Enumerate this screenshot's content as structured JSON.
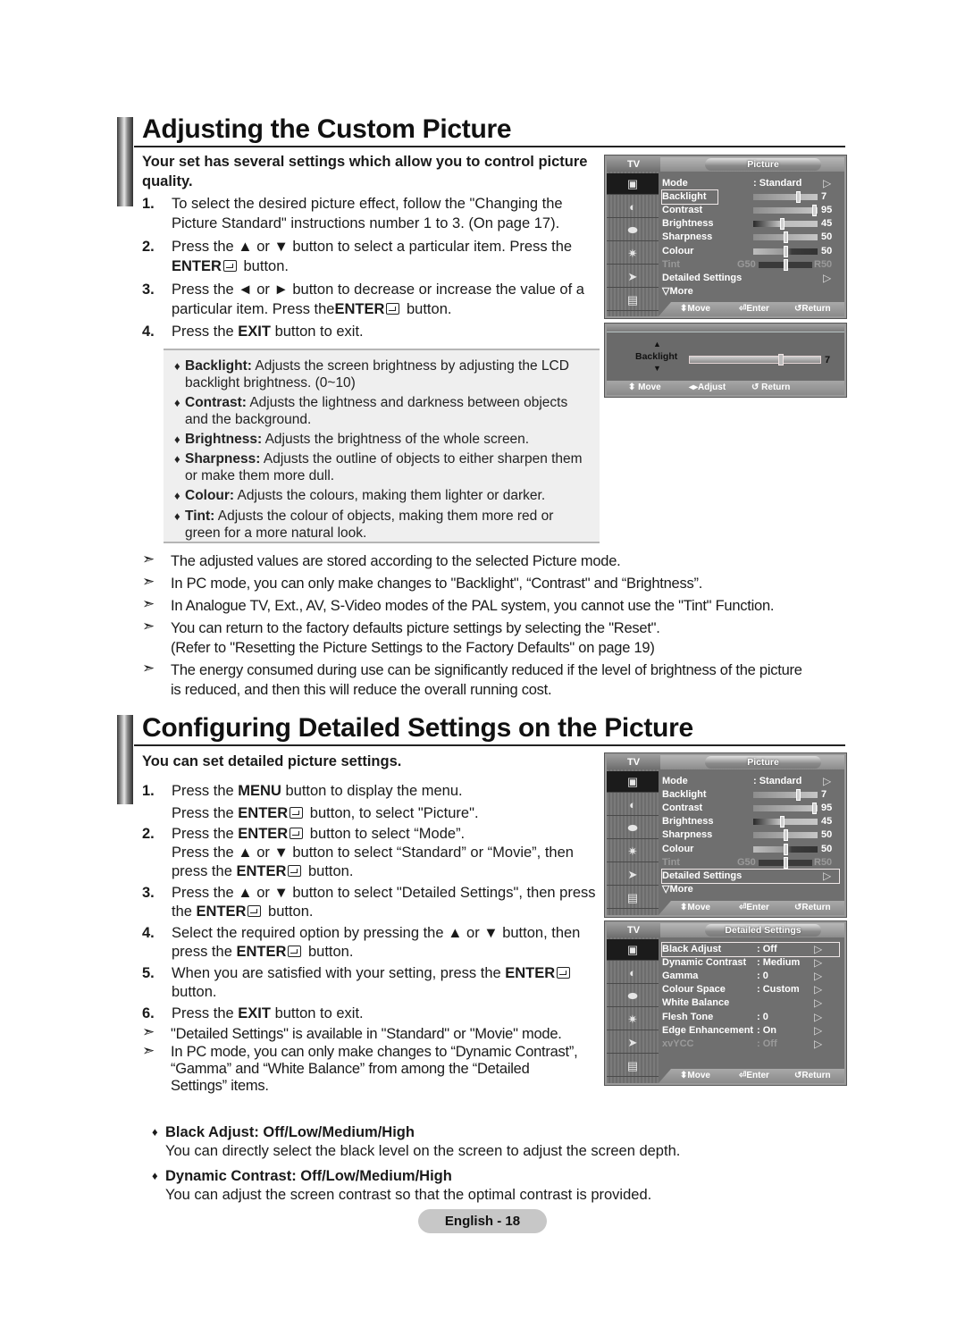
{
  "section1": {
    "title": "Adjusting the Custom Picture",
    "intro": "Your set has several settings which allow you to control picture quality.",
    "steps": [
      {
        "num": "1.",
        "lines": [
          "To select the desired picture effect, follow the \"Changing the",
          "Picture Standard\" instructions number 1 to 3. (On page 17)."
        ]
      },
      {
        "num": "2.",
        "line1": "Press the ▲ or ▼ button to select a particular item. Press the",
        "line2_bold": "ENTER",
        "line2_rest": " button."
      },
      {
        "num": "3.",
        "line1": "Press the ◄ or ► button to decrease or increase the value of a",
        "line2_pre": "particular item. Press the",
        "line2_bold": "ENTER",
        "line2_rest": " button."
      },
      {
        "num": "4.",
        "pre": "Press the ",
        "bold": "EXIT",
        "rest": " button to exit."
      }
    ],
    "descriptions": [
      {
        "term": "Backlight:",
        "text": " Adjusts the screen brightness by adjusting the LCD",
        "text2": "backlight brightness. (0~10)"
      },
      {
        "term": "Contrast:",
        "text": " Adjusts the lightness and darkness between objects",
        "text2": "and the background."
      },
      {
        "term": "Brightness:",
        "text": " Adjusts the brightness of the whole screen.",
        "text2": ""
      },
      {
        "term": "Sharpness:",
        "text": " Adjusts the outline of objects to either sharpen them",
        "text2": "or make them more dull."
      },
      {
        "term": "Colour:",
        "text": " Adjusts the colours, making them lighter or darker.",
        "text2": ""
      },
      {
        "term": "Tint:",
        "text": " Adjusts the colour of objects, making them more red or",
        "text2": "green for a more natural look."
      }
    ],
    "notes": [
      "The adjusted values are stored according to the selected Picture mode.",
      "In PC mode, you can only make changes to \"Backlight\", “Contrast\" and “Brightness”.",
      "In Analogue TV, Ext., AV, S-Video modes of the PAL system, you cannot use the \"Tint\" Function.",
      "You can return to the factory defaults picture settings by selecting the \"Reset\".",
      "The energy consumed during use can be significantly reduced if the level of brightness of the picture"
    ],
    "note4_line2": "(Refer to \"Resetting the Picture Settings to the Factory Defaults\" on page 19)",
    "note5_line2": "is reduced, and then this will reduce the overall running cost."
  },
  "section2": {
    "title": "Configuring Detailed Settings on the Picture",
    "intro": "You can set detailed picture settings.",
    "steps": {
      "s1": {
        "num": "1.",
        "a_pre": "Press the ",
        "a_bold": "MENU",
        "a_rest": " button to display the menu.",
        "b_pre": "Press the ",
        "b_bold": "ENTER",
        "b_rest": " button, to select \"Picture\"."
      },
      "s2": {
        "num": "2.",
        "a_pre": "Press the ",
        "a_bold": "ENTER",
        "a_rest": " button to select “Mode”.",
        "b": "Press the ▲ or ▼ button to select “Standard” or “Movie”, then",
        "c_pre": "press the ",
        "c_bold": "ENTER",
        "c_rest": " button."
      },
      "s3": {
        "num": "3.",
        "a": "Press the ▲ or ▼ button to select \"Detailed Settings\", then press",
        "b_pre": "the ",
        "b_bold": "ENTER",
        "b_rest": " button."
      },
      "s4": {
        "num": "4.",
        "a": "Select the required option by pressing the ▲ or ▼ button, then",
        "b_pre": "press the ",
        "b_bold": "ENTER",
        "b_rest": " button."
      },
      "s5": {
        "num": "5.",
        "a_pre": "When you are satisfied with your setting, press the ",
        "a_bold": "ENTER",
        "b": "button."
      },
      "s6": {
        "num": "6.",
        "a_pre": "Press the ",
        "a_bold": "EXIT",
        "a_rest": " button to exit."
      }
    },
    "notes": [
      {
        "lines": [
          "\"Detailed Settings\" is available in \"Standard\" or \"Movie\" mode."
        ]
      },
      {
        "lines": [
          "In PC mode, you can only make changes to “Dynamic Contrast”,",
          "“Gamma” and “White Balance” from among the “Detailed",
          "Settings” items."
        ]
      }
    ],
    "options": [
      {
        "title": "Black Adjust: Off/Low/Medium/High",
        "desc": "You can directly select the black level on the screen to adjust the screen depth."
      },
      {
        "title": "Dynamic Contrast: Off/Low/Medium/High",
        "desc": "You can adjust the screen contrast so that the optimal contrast is provided."
      }
    ]
  },
  "osd_picture": {
    "tv_label": "TV",
    "title": "Picture",
    "items": [
      {
        "label": "Mode",
        "value": ": Standard",
        "arrow": "▷"
      },
      {
        "label": "Backlight",
        "slider": 0.7,
        "value": "7"
      },
      {
        "label": "Contrast",
        "slider": 0.95,
        "value": "95"
      },
      {
        "label": "Brightness",
        "slider": 0.45,
        "value": "45"
      },
      {
        "label": "Sharpness",
        "slider": 0.5,
        "value": "50"
      },
      {
        "label": "Colour",
        "slider": 0.5,
        "value": "50"
      },
      {
        "label": "Tint",
        "left": "G50",
        "right": "R50",
        "slider": 0.5
      },
      {
        "label": "Detailed Settings",
        "arrow": "▷"
      },
      {
        "label": "▽More"
      }
    ],
    "footer": {
      "move": "Move",
      "enter": "Enter",
      "return": "Return",
      "adjust": "Adjust"
    }
  },
  "osd_backlight": {
    "label": "Backlight",
    "value": "7",
    "level": 0.7
  },
  "osd_detailed": {
    "title": "Detailed Settings",
    "items": [
      {
        "label": "Black Adjust",
        "value": ": Off"
      },
      {
        "label": "Dynamic Contrast",
        "value": ": Medium"
      },
      {
        "label": "Gamma",
        "value": ": 0"
      },
      {
        "label": "Colour Space",
        "value": ": Custom"
      },
      {
        "label": "White Balance",
        "value": ""
      },
      {
        "label": "Flesh Tone",
        "value": ": 0"
      },
      {
        "label": "Edge Enhancement",
        "value": ": On"
      },
      {
        "label": "xvYCC",
        "value": ": Off"
      }
    ]
  },
  "footer": {
    "page": "English - 18"
  }
}
